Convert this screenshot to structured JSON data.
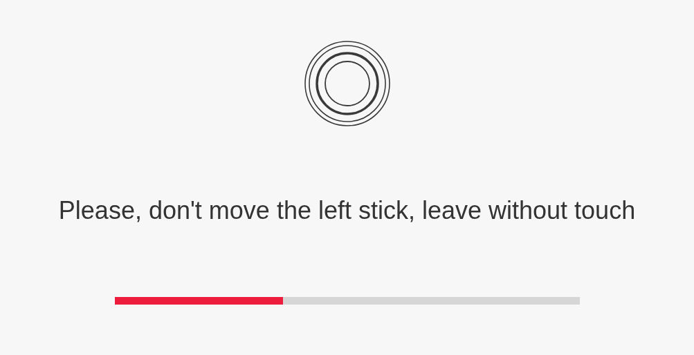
{
  "instruction": "Please, don't move the left stick, leave without touch",
  "progress": {
    "level": 0.363
  }
}
